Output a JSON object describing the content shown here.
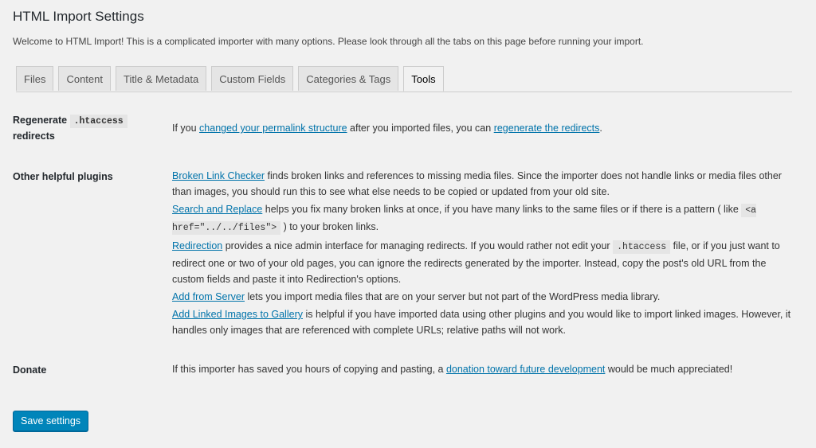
{
  "page": {
    "title": "HTML Import Settings",
    "intro": "Welcome to HTML Import! This is a complicated importer with many options. Please look through all the tabs on this page before running your import."
  },
  "tabs": [
    {
      "label": "Files",
      "active": false
    },
    {
      "label": "Content",
      "active": false
    },
    {
      "label": "Title & Metadata",
      "active": false
    },
    {
      "label": "Custom Fields",
      "active": false
    },
    {
      "label": "Categories & Tags",
      "active": false
    },
    {
      "label": "Tools",
      "active": true
    }
  ],
  "regenerate": {
    "label_pre": "Regenerate",
    "label_code": ".htaccess",
    "label_post": "redirects",
    "text_1": "If you ",
    "link_1": "changed your permalink structure",
    "text_2": " after you imported files, you can ",
    "link_2": "regenerate the redirects",
    "text_3": "."
  },
  "plugins": {
    "label": "Other helpful plugins",
    "broken": {
      "link": "Broken Link Checker",
      "text": " finds broken links and references to missing media files. Since the importer does not handle links or media files other than images, you should run this to see what else needs to be copied or updated from your old site."
    },
    "search": {
      "link": "Search and Replace",
      "text_1": " helps you fix many broken links at once, if you have many links to the same files or if there is a pattern ( like ",
      "code": "<a href=\"../../files\">",
      "text_2": " ) to your broken links."
    },
    "redirection": {
      "link": "Redirection",
      "text_1": " provides a nice admin interface for managing redirects. If you would rather not edit your ",
      "code": ".htaccess",
      "text_2": " file, or if you just want to redirect one or two of your old pages, you can ignore the redirects generated by the importer. Instead, copy the post's old URL from the custom fields and paste it into Redirection's options."
    },
    "server": {
      "link": "Add from Server",
      "text": " lets you import media files that are on your server but not part of the WordPress media library."
    },
    "gallery": {
      "link": "Add Linked Images to Gallery",
      "text": " is helpful if you have imported data using other plugins and you would like to import linked images. However, it handles only images that are referenced with complete URLs; relative paths will not work."
    }
  },
  "donate": {
    "label": "Donate",
    "text_1": "If this importer has saved you hours of copying and pasting, a ",
    "link": "donation toward future development",
    "text_2": " would be much appreciated!"
  },
  "save_button": "Save settings",
  "colors": {
    "background": "#f1f1f1",
    "link": "#0073aa",
    "primary_button": "#0085ba"
  }
}
